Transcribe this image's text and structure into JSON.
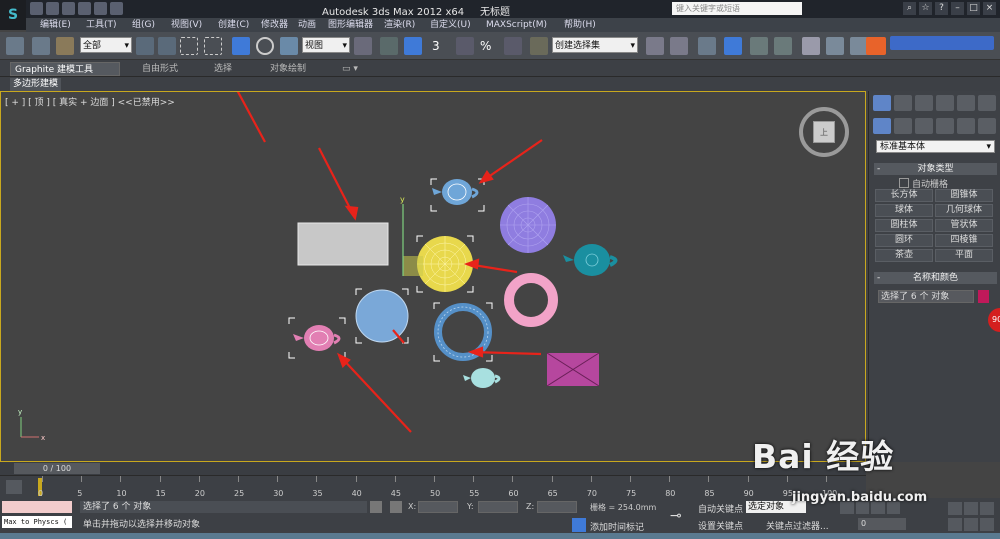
{
  "window": {
    "title": "Autodesk 3ds Max  2012 x64",
    "doc_title": "无标题",
    "search_placeholder": "键入关键字或短语"
  },
  "menu": [
    "编辑(E)",
    "工具(T)",
    "组(G)",
    "视图(V)",
    "创建(C)",
    "修改器",
    "动画",
    "图形编辑器",
    "渲染(R)",
    "自定义(U)",
    "MAXScript(M)",
    "帮助(H)"
  ],
  "toolbar": {
    "selection_filter": "全部",
    "ref_coord": "视图",
    "named_selection": "创建选择集",
    "snap_3": "3",
    "snap_pct": "%"
  },
  "ribbon": {
    "tabs": [
      "Graphite 建模工具",
      "自由形式",
      "选择",
      "对象绘制"
    ],
    "active_tab": "Graphite 建模工具",
    "subtab": "多边形建模"
  },
  "viewport": {
    "label": "[ + ] [ 顶 ] [ 真实 + 边面 ] <<已禁用>>",
    "viewcube_face": "上"
  },
  "command_panel": {
    "category": "标准基本体",
    "object_type_header": "对象类型",
    "autogrid": "自动栅格",
    "object_buttons": [
      "长方体",
      "圆锥体",
      "球体",
      "几何球体",
      "圆柱体",
      "管状体",
      "圆环",
      "四棱锥",
      "茶壶",
      "平面"
    ],
    "name_color_header": "名称和颜色",
    "name_value": "选择了 6 个 对象",
    "color": "#c0195a"
  },
  "time": {
    "slider_label": "0 / 100",
    "ticks": [
      "0",
      "5",
      "10",
      "15",
      "20",
      "25",
      "30",
      "35",
      "40",
      "45",
      "50",
      "55",
      "60",
      "65",
      "70",
      "75",
      "80",
      "85",
      "90",
      "95",
      "100"
    ]
  },
  "status": {
    "maxscript_line": "Max to Physcs (",
    "line1": "选择了 6 个 对象",
    "line2": "单击并拖动以选择并移动对象",
    "x_label": "X:",
    "y_label": "Y:",
    "z_label": "Z:",
    "grid": "栅格 = 254.0mm",
    "add_tag": "添加时间标记",
    "auto_key": "自动关键点",
    "set_key": "设置关键点",
    "key_select": "选定对象",
    "key_filter": "关键点过滤器...",
    "frame": "0"
  },
  "watermark": {
    "brand": "Bai 经验",
    "url": "jingyan.baidu.com"
  },
  "float_badge": "90",
  "objects": [
    {
      "name": "box",
      "color": "#c8c8c8"
    },
    {
      "name": "cone",
      "color": "#8f7de0"
    },
    {
      "name": "teapot-cyan",
      "color": "#1a8fa0"
    },
    {
      "name": "sphere-yellow",
      "color": "#e8d84c"
    },
    {
      "name": "torus-pink",
      "color": "#f2a3c8"
    },
    {
      "name": "teapot-blue",
      "color": "#6fa6d8"
    },
    {
      "name": "cylinder-blue",
      "color": "#7aa8d8"
    },
    {
      "name": "torus-blue",
      "color": "#5590c8"
    },
    {
      "name": "teapot-pink",
      "color": "#e27fb3"
    },
    {
      "name": "teapot-mint",
      "color": "#a8e0e0"
    },
    {
      "name": "pyramid",
      "color": "#b6479e"
    }
  ]
}
